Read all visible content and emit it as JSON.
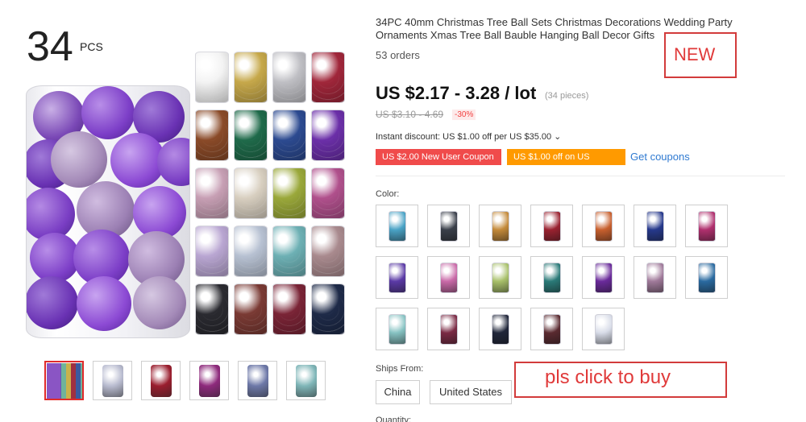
{
  "gallery": {
    "pcs_count": "34",
    "pcs_unit": "PCS",
    "thumbnails": [
      {
        "color": "#7b43b8"
      },
      {
        "color": "#b9bcd0"
      },
      {
        "color": "#9a1e2e"
      },
      {
        "color": "#8e2a7c"
      },
      {
        "color": "#6d78a8"
      },
      {
        "color": "#7fb6b8"
      }
    ],
    "grid_colors": [
      [
        "#f3f3f3",
        "#c6a84a",
        "#bfbfc4",
        "#a0263a"
      ],
      [
        "#8a4a28",
        "#1f6a4a",
        "#2c4a90",
        "#6b2fa8"
      ],
      [
        "#c79fb4",
        "#d8cfc0",
        "#9aa83a",
        "#b0508c"
      ],
      [
        "#b9a6d2",
        "#b7c1d2",
        "#6db0b4",
        "#a98a8e"
      ],
      [
        "#2a2a30",
        "#7a3a34",
        "#7a2436",
        "#1e2a48"
      ]
    ]
  },
  "product": {
    "title": "34PC 40mm Christmas Tree Ball Sets Christmas Decorations Wedding Party Ornaments Xmas Tree Ball Bauble Hanging Ball Decor Gifts",
    "orders": "53 orders",
    "new_label": "NEW",
    "price": "US $2.17 - 3.28 / lot",
    "price_unit": "(34 pieces)",
    "old_price": "US $3.10 - 4.69",
    "discount_pct": "-30%",
    "instant_discount": "Instant discount: US $1.00 off per US $35.00 ⌄",
    "coupon_new_user": "US $2.00 New User Coupon",
    "coupon_store": "US $1.00 off on US $16.00",
    "get_coupons": "Get coupons",
    "color_label": "Color:",
    "swatch_colors": [
      "#4aa3c6",
      "#3a3f4a",
      "#c48a3a",
      "#9a2230",
      "#c8602e",
      "#26398c",
      "#b0306e",
      "#5b3aa6",
      "#c96aa8",
      "#a8c06a",
      "#2a7a78",
      "#6a2a9a",
      "#a07a9a",
      "#2a6aa0",
      "#86c2c2",
      "#7a2a44",
      "#20263a",
      "#5a2a30",
      "#d8dce8"
    ],
    "ships_from_label": "Ships From:",
    "ship_options": [
      "China",
      "United States"
    ],
    "quantity_label": "Quantity:",
    "buy_note": "pls click to buy"
  }
}
